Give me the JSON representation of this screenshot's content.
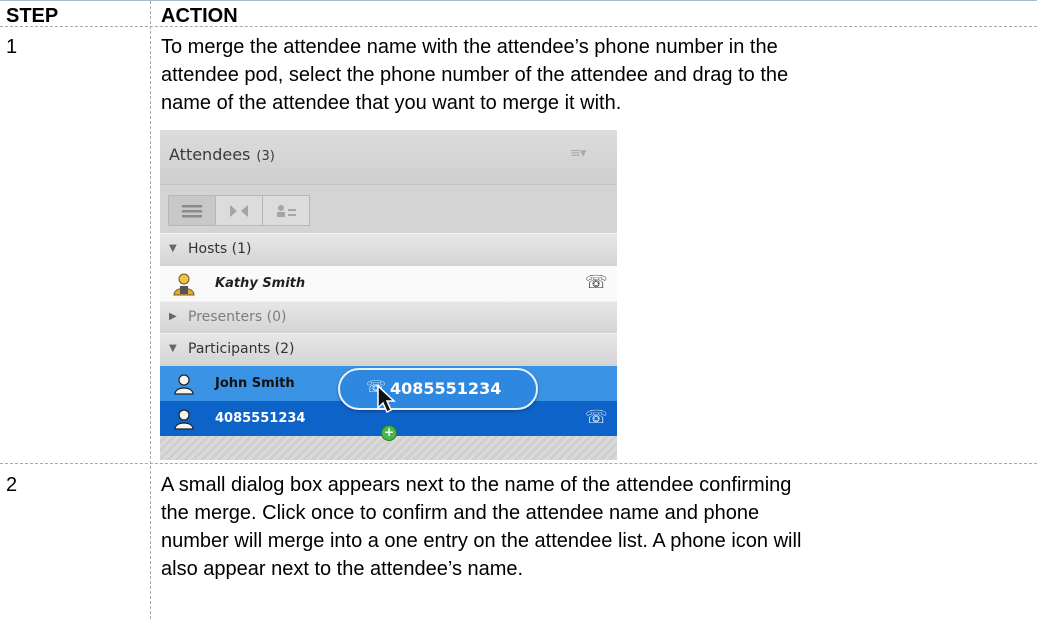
{
  "table": {
    "header": {
      "step": "STEP",
      "action": "ACTION"
    },
    "rows": [
      {
        "step": "1",
        "lines": [
          "To merge the attendee name with the attendee’s phone number in the",
          "attendee pod, select the phone number of the attendee and drag to the",
          "name of the attendee that you want to merge it with."
        ]
      },
      {
        "step": "2",
        "lines": [
          "A small dialog box appears next to the name of the attendee confirming",
          "the merge. Click once to confirm and the attendee name and phone",
          "number will merge into a one entry on the attendee list.  A phone icon will",
          "also appear next to the attendee’s name."
        ]
      }
    ]
  },
  "pod": {
    "title": "Attendees",
    "count": "(3)",
    "sections": {
      "hosts": "Hosts (1)",
      "presenters": "Presenters (0)",
      "participants": "Participants (2)"
    },
    "host_name": "Kathy Smith",
    "participant_name": "John Smith",
    "participant_number": "4085551234",
    "drag_label": "4085551234"
  },
  "colors": {
    "selected_row": "#3b93e6",
    "dragged_row": "#0e63c9",
    "drag_bubble": "#2f88e0"
  }
}
